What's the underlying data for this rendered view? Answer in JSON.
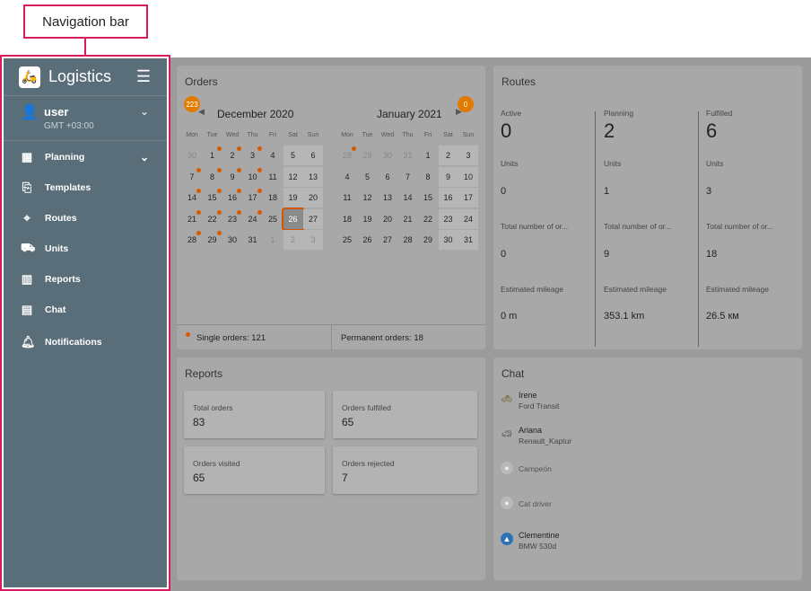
{
  "callout": {
    "label": "Navigation bar",
    "color": "#d81b60"
  },
  "app": {
    "title": "Logistics"
  },
  "user": {
    "name": "user",
    "timezone": "GMT +03:00"
  },
  "nav": [
    {
      "label": "Planning",
      "icon": "calendar-icon",
      "expandable": true
    },
    {
      "label": "Templates",
      "icon": "template-icon"
    },
    {
      "label": "Routes",
      "icon": "route-icon"
    },
    {
      "label": "Units",
      "icon": "car-icon"
    },
    {
      "label": "Reports",
      "icon": "bar-chart-icon"
    },
    {
      "label": "Chat",
      "icon": "chat-icon"
    },
    {
      "label": "Notifications",
      "icon": "bell-icon"
    }
  ],
  "orders": {
    "title": "Orders",
    "badge_left": "223",
    "badge_right": "0",
    "weekdays": [
      "Mon",
      "Tue",
      "Wed",
      "Thu",
      "Fri",
      "Sat",
      "Sun"
    ],
    "month_left": {
      "title": "December 2020",
      "weeks": [
        [
          "30",
          "1",
          "2",
          "3",
          "4",
          "5",
          "6"
        ],
        [
          "7",
          "8",
          "9",
          "10",
          "11",
          "12",
          "13"
        ],
        [
          "14",
          "15",
          "16",
          "17",
          "18",
          "19",
          "20"
        ],
        [
          "21",
          "22",
          "23",
          "24",
          "25",
          "26",
          "27"
        ],
        [
          "28",
          "29",
          "30",
          "31",
          "1",
          "2",
          "3"
        ]
      ]
    },
    "month_right": {
      "title": "January 2021",
      "weeks": [
        [
          "28",
          "29",
          "30",
          "31",
          "1",
          "2",
          "3"
        ],
        [
          "4",
          "5",
          "6",
          "7",
          "8",
          "9",
          "10"
        ],
        [
          "11",
          "12",
          "13",
          "14",
          "15",
          "16",
          "17"
        ],
        [
          "18",
          "19",
          "20",
          "21",
          "22",
          "23",
          "24"
        ],
        [
          "25",
          "26",
          "27",
          "28",
          "29",
          "30",
          "31"
        ]
      ]
    },
    "single_orders": "Single orders: 121",
    "permanent_orders": "Permanent orders: 18",
    "dot_color": "#d85a00"
  },
  "routes": {
    "title": "Routes",
    "columns": [
      {
        "status": "Active",
        "count": "0",
        "units_label": "Units",
        "units": "0",
        "orders_label": "Total number of or...",
        "orders": "0",
        "mileage_label": "Estimated mileage",
        "mileage": "0 m"
      },
      {
        "status": "Planning",
        "count": "2",
        "units_label": "Units",
        "units": "1",
        "orders_label": "Total number of or...",
        "orders": "9",
        "mileage_label": "Estimated mileage",
        "mileage": "353.1 km"
      },
      {
        "status": "Fulfilled",
        "count": "6",
        "units_label": "Units",
        "units": "3",
        "orders_label": "Total number of or...",
        "orders": "18",
        "mileage_label": "Estimated mileage",
        "mileage": "26.5 км"
      }
    ]
  },
  "reports": {
    "title": "Reports",
    "cards": [
      {
        "label": "Total orders",
        "value": "83"
      },
      {
        "label": "Orders fulfilled",
        "value": "65"
      },
      {
        "label": "Orders visited",
        "value": "65"
      },
      {
        "label": "Orders rejected",
        "value": "7"
      }
    ]
  },
  "chat": {
    "title": "Chat",
    "items": [
      {
        "name": "Irene",
        "sub": "Ford Transit",
        "icon": "car-icon"
      },
      {
        "name": "Ariana",
        "sub": "Renault_Kaptur",
        "icon": "car-icon"
      },
      {
        "name": "Campeón",
        "sub": "",
        "icon": "person-icon"
      },
      {
        "name": "Cat driver",
        "sub": "",
        "icon": "person-icon"
      },
      {
        "name": "Clementine",
        "sub": "BMW 530d",
        "icon": "navigation-icon"
      }
    ]
  }
}
